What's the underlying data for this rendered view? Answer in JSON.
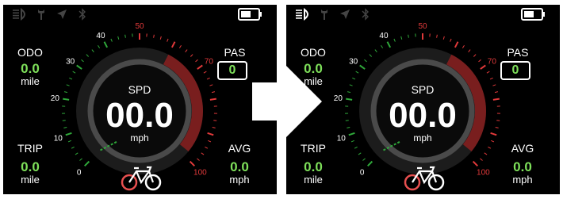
{
  "panels": [
    {
      "id": "before",
      "odo": {
        "label": "ODO",
        "value": "0.0",
        "unit": "mile"
      },
      "pas": {
        "label": "PAS",
        "value": "0"
      },
      "trip": {
        "label": "TRIP",
        "value": "0.0",
        "unit": "mile"
      },
      "avg": {
        "label": "AVG",
        "value": "0.0",
        "unit": "mph"
      },
      "speed": {
        "label": "SPD",
        "value": "00.0",
        "unit": "mph"
      },
      "headlight_on": false,
      "status_icons": [
        "headlight-icon",
        "wrench-icon",
        "navigation-icon",
        "bluetooth-icon",
        "battery-icon"
      ]
    },
    {
      "id": "after",
      "odo": {
        "label": "ODO",
        "value": "0.0",
        "unit": "mile"
      },
      "pas": {
        "label": "PAS",
        "value": "0"
      },
      "trip": {
        "label": "TRIP",
        "value": "0.0",
        "unit": "mile"
      },
      "avg": {
        "label": "AVG",
        "value": "0.0",
        "unit": "mph"
      },
      "speed": {
        "label": "SPD",
        "value": "00.0",
        "unit": "mph"
      },
      "headlight_on": true,
      "status_icons": [
        "headlight-icon",
        "wrench-icon",
        "navigation-icon",
        "bluetooth-icon",
        "battery-icon"
      ]
    }
  ],
  "gauge": {
    "min": 0,
    "max": 100,
    "tick_labels": [
      "0",
      "10",
      "20",
      "30",
      "40",
      "50",
      "70",
      "100"
    ],
    "red_zone_start": 50
  },
  "colors": {
    "value_green": "#7ee05a",
    "tick_green": "#2fa83a",
    "tick_red": "#e0393a",
    "bike_red": "#e85050",
    "panel_bg": "#000000"
  },
  "transition_arrow": "arrow-right-icon"
}
